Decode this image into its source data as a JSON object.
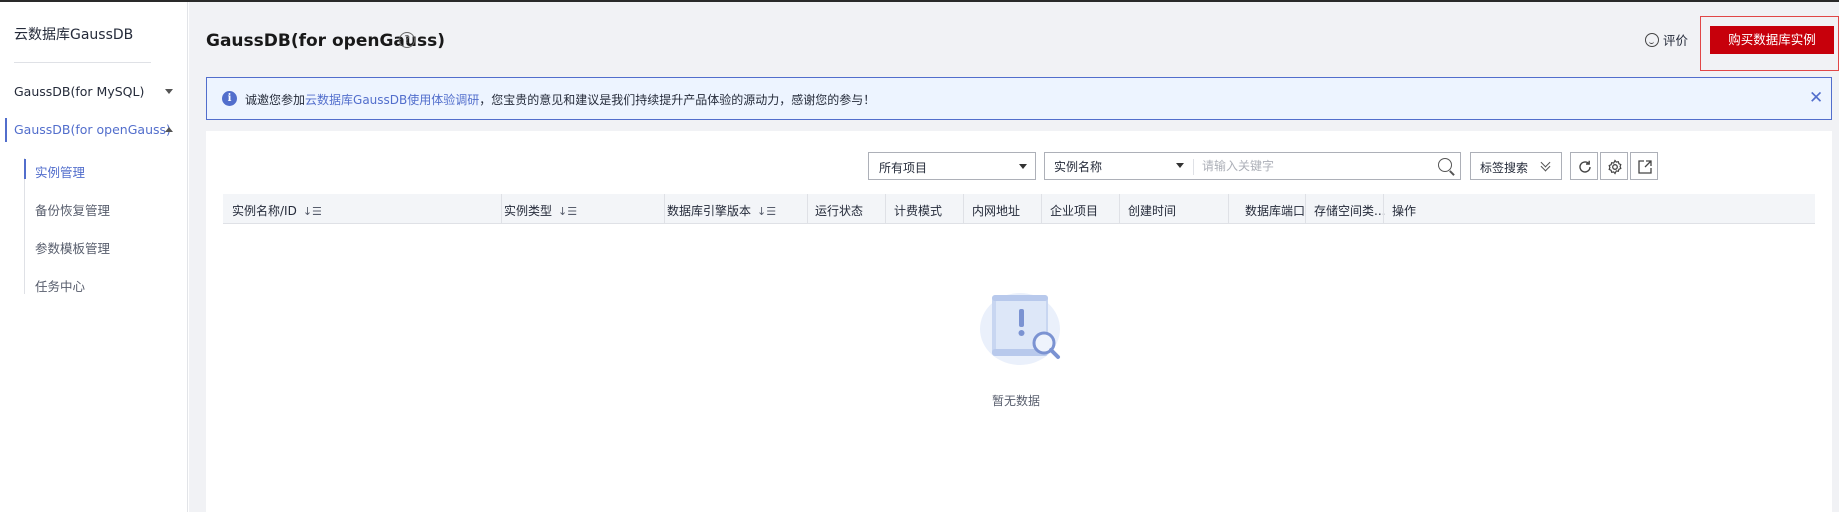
{
  "sidebar": {
    "title": "云数据库GaussDB",
    "groups": [
      {
        "label": "GaussDB(for MySQL)",
        "expanded": false
      },
      {
        "label": "GaussDB(for openGauss)",
        "expanded": true
      }
    ],
    "items": [
      "实例管理",
      "备份恢复管理",
      "参数模板管理",
      "任务中心"
    ],
    "active_item": "实例管理"
  },
  "header": {
    "title": "GaussDB(for openGauss)",
    "help_icon": "question-circle-icon",
    "feedback_label": "评价",
    "buy_button": "购买数据库实例"
  },
  "notice": {
    "prefix": "诚邀您参加",
    "link": "云数据库GaussDB使用体验调研",
    "suffix": "，您宝贵的意见和建议是我们持续提升产品体验的源动力，感谢您的参与！",
    "icon": "info-icon"
  },
  "toolbar": {
    "project_select": "所有项目",
    "search_field": "实例名称",
    "search_placeholder": "请输入关键字",
    "tag_search": "标签搜索"
  },
  "table": {
    "columns": [
      "实例名称/ID",
      "实例类型",
      "数据库引擎版本",
      "运行状态",
      "计费模式",
      "内网地址",
      "企业项目",
      "创建时间",
      "数据库端口",
      "存储空间类...",
      "操作"
    ],
    "rows": [],
    "empty_text": "暂无数据"
  },
  "colors": {
    "accent": "#526ecc",
    "buy_button": "#c7000b",
    "notice_bg": "#edf4ff"
  }
}
